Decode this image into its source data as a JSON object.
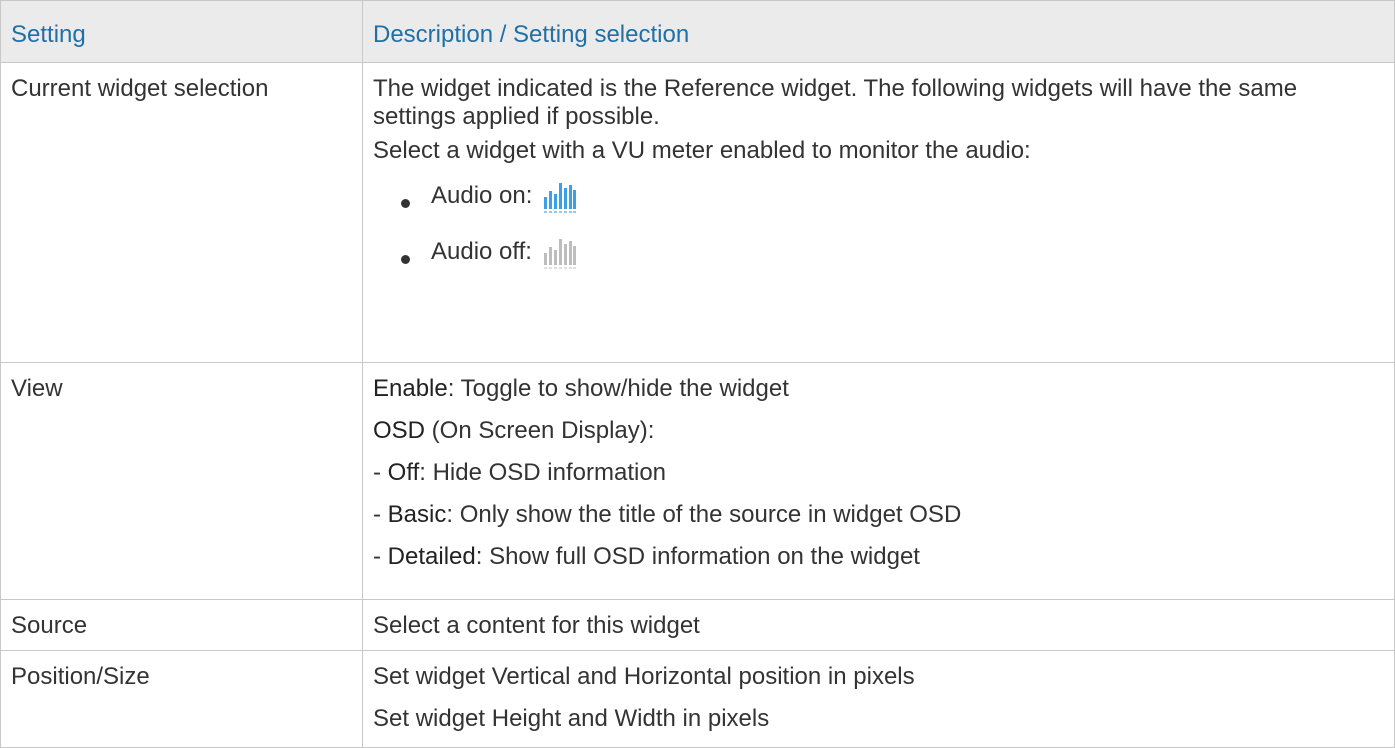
{
  "header": {
    "setting": "Setting",
    "description": "Description / Setting selection"
  },
  "rows": {
    "current_widget": {
      "label": "Current widget selection",
      "line1": "The widget indicated is the Reference widget. The following widgets will have the same settings applied if possible.",
      "line2": "Select a widget with a VU meter enabled to monitor the audio:",
      "audio_on": "Audio on:",
      "audio_off": "Audio off:",
      "audio_on_icon": "vu-meter-icon",
      "audio_on_color": "#3aa0ea",
      "audio_off_icon": "vu-meter-icon",
      "audio_off_color": "#bdbdbd"
    },
    "view": {
      "label": "View",
      "enable_term": "Enable",
      "enable_text": ": Toggle to show/hide the widget",
      "osd_term": "OSD",
      "osd_text": " (On Screen Display):",
      "off_prefix": "- ",
      "off_term": "Off",
      "off_text": ": Hide OSD information",
      "basic_prefix": "- ",
      "basic_term": "Basic",
      "basic_text": ": Only show the title of the source in widget OSD",
      "detailed_prefix": "- ",
      "detailed_term": "Detailed",
      "detailed_text": ": Show full OSD information on the widget"
    },
    "source": {
      "label": "Source",
      "text": "Select a content for this widget"
    },
    "position": {
      "label": "Position/Size",
      "line1": "Set widget Vertical and Horizontal position in pixels",
      "line2": "Set widget Height and Width in pixels"
    }
  },
  "colors": {
    "header_text": "#1f6fa8",
    "header_bg": "#ebebeb",
    "border": "#c8c8c8"
  }
}
